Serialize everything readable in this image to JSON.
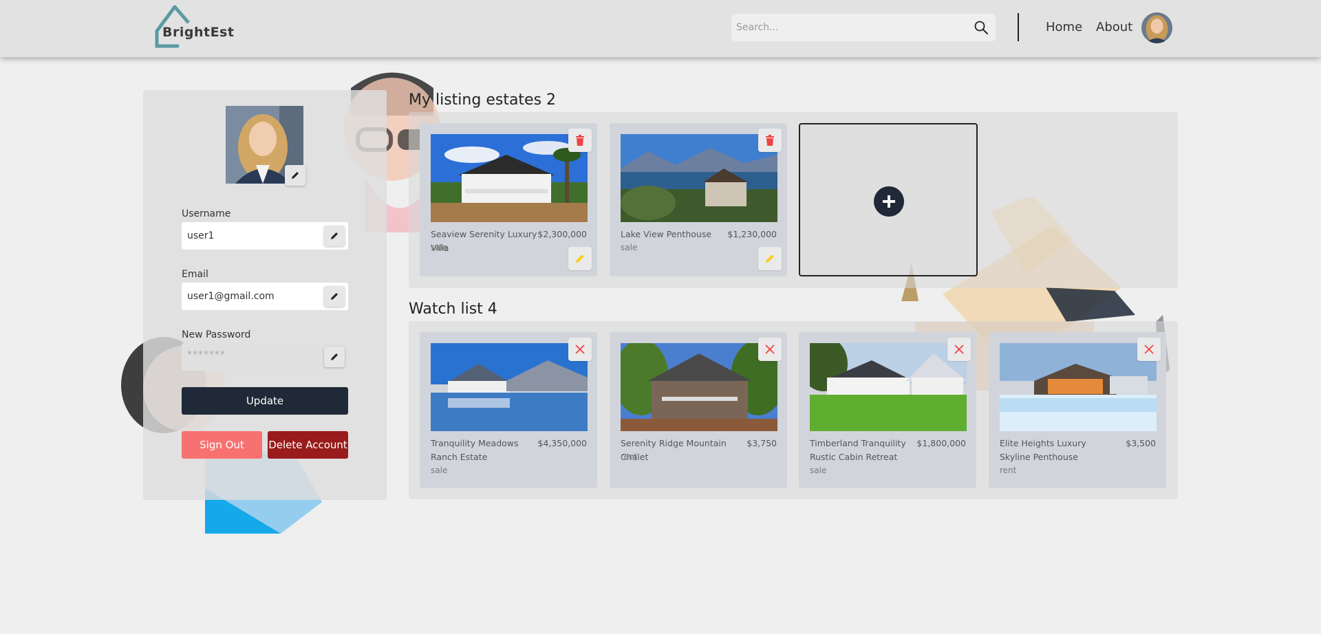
{
  "header": {
    "logo_text": "BrightEst",
    "search_placeholder": "Search...",
    "nav": {
      "home": "Home",
      "about": "About"
    }
  },
  "profile": {
    "username_label": "Username",
    "username_value": "user1",
    "email_label": "Email",
    "email_value": "user1@gmail.com",
    "password_label": "New Password",
    "password_value": "*******",
    "update_label": "Update",
    "signout_label": "Sign Out",
    "delete_label": "Delete Account"
  },
  "listings": {
    "title": "My listing estates 2",
    "items": [
      {
        "name": "Seaview Serenity Luxury Villa",
        "price": "$2,300,000",
        "type": "sale"
      },
      {
        "name": "Lake View Penthouse",
        "price": "$1,230,000",
        "type": "sale"
      }
    ]
  },
  "watchlist": {
    "title": "Watch list 4",
    "items": [
      {
        "name": "Tranquility Meadows Ranch Estate",
        "price": "$4,350,000",
        "type": "sale"
      },
      {
        "name": "Serenity Ridge Mountain Chalet",
        "price": "$3,750",
        "type": "rent"
      },
      {
        "name": "Timberland Tranquility Rustic Cabin Retreat",
        "price": "$1,800,000",
        "type": "sale"
      },
      {
        "name": "Elite Heights Luxury Skyline Penthouse",
        "price": "$3,500",
        "type": "rent"
      }
    ]
  },
  "colors": {
    "header_bg": "#e2e2e2",
    "dark_button": "#1f2937",
    "signout": "#f87171",
    "delete": "#991b1b",
    "trash_icon": "#ef4444",
    "edit_icon": "#facc15",
    "logo_teal": "#5b9aa3"
  },
  "icons": [
    "house-logo-icon",
    "search-icon",
    "pencil-icon",
    "trash-icon",
    "close-icon",
    "plus-icon"
  ]
}
